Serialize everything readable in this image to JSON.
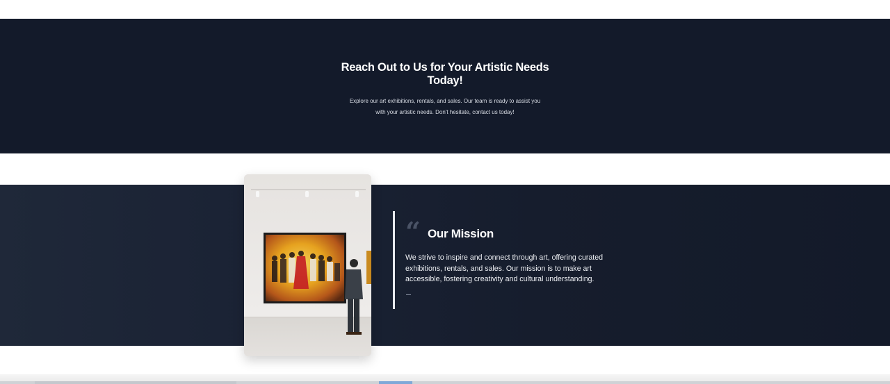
{
  "cta": {
    "title": "Reach Out to Us for Your Artistic Needs Today!",
    "body": "Explore our art exhibitions, rentals, and sales. Our team is ready to assist you with your artistic needs. Don't hesitate, contact us today!"
  },
  "mission": {
    "quote_icon": "quote-icon",
    "title": "Our Mission",
    "body": "We strive to inspire and connect through art, offering curated exhibitions, rentals, and sales. Our mission is to make art accessible, fostering creativity and cultural understanding.",
    "image_alt": "Man viewing a large colorful painting in a gallery"
  },
  "colors": {
    "dark_band": "#131a2a",
    "mission_gradient_start": "#1f2839",
    "mission_gradient_end": "#131a29",
    "accent_bar": "#e7e9ee"
  }
}
